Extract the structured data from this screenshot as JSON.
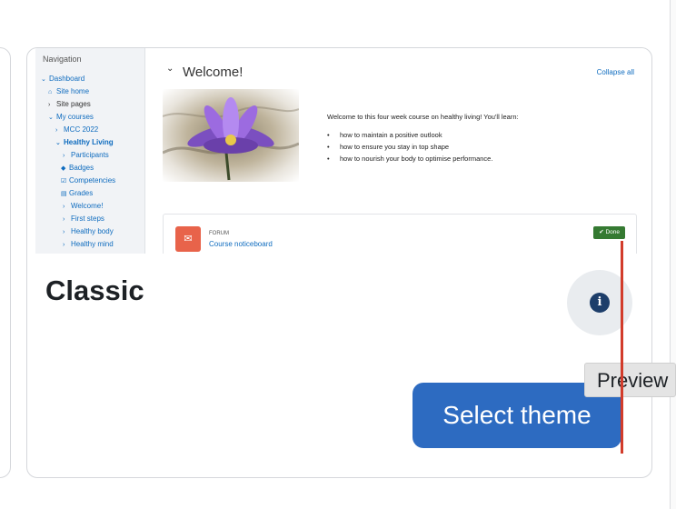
{
  "thumbnail": {
    "nav": {
      "title": "Navigation",
      "items": [
        {
          "label": "Dashboard",
          "icon": "chevron-down-icon"
        },
        {
          "label": "Site home",
          "icon": "home-icon"
        },
        {
          "label": "Site pages",
          "icon": "chevron-right-icon"
        },
        {
          "label": "My courses",
          "icon": "chevron-down-icon"
        },
        {
          "label": "MCC 2022",
          "icon": "chevron-right-icon"
        },
        {
          "label": "Healthy Living",
          "icon": "chevron-down-icon"
        },
        {
          "label": "Participants",
          "icon": "chevron-right-icon"
        },
        {
          "label": "Badges",
          "icon": "shield-icon"
        },
        {
          "label": "Competencies",
          "icon": "checkbox-icon"
        },
        {
          "label": "Grades",
          "icon": "table-icon"
        },
        {
          "label": "Welcome!",
          "icon": "chevron-right-icon"
        },
        {
          "label": "First steps",
          "icon": "chevron-right-icon"
        },
        {
          "label": "Healthy body",
          "icon": "chevron-right-icon"
        },
        {
          "label": "Healthy mind",
          "icon": "chevron-right-icon"
        }
      ]
    },
    "section_title": "Welcome!",
    "collapse_all": "Collapse all",
    "intro": "Welcome to this four week course on healthy living! You'll learn:",
    "bullets": [
      "how to maintain a positive outlook",
      "how to ensure you stay in top shape",
      "how to nourish your body to optimise performance."
    ],
    "forum": {
      "type": "FORUM",
      "name": "Course noticeboard",
      "badge": "Done"
    }
  },
  "card": {
    "title": "Classic",
    "info_icon": "info-icon",
    "select_label": "Select theme",
    "tooltip": "Preview"
  },
  "colors": {
    "primary": "#2d6bc1",
    "link": "#0f6cbf",
    "info_dark": "#1d3e6a",
    "done_green": "#357a32",
    "forum_orange": "#e8634a",
    "annotation_red": "#d23c2b"
  }
}
